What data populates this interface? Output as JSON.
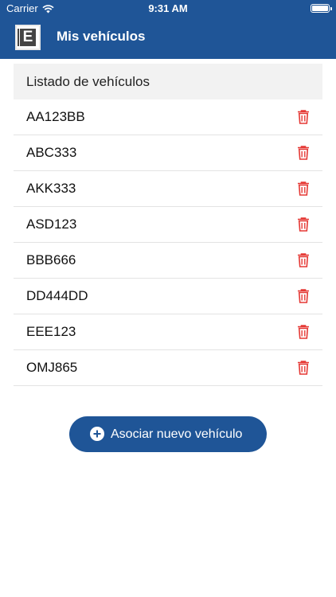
{
  "status_bar": {
    "carrier": "Carrier",
    "time": "9:31 AM"
  },
  "header": {
    "title": "Mis vehículos"
  },
  "list": {
    "heading": "Listado de vehículos",
    "items": [
      {
        "plate": "AA123BB"
      },
      {
        "plate": "ABC333"
      },
      {
        "plate": "AKK333"
      },
      {
        "plate": "ASD123"
      },
      {
        "plate": "BBB666"
      },
      {
        "plate": "DD444DD"
      },
      {
        "plate": "EEE123"
      },
      {
        "plate": "OMJ865"
      }
    ]
  },
  "actions": {
    "add_vehicle_label": "Asociar nuevo vehículo"
  },
  "colors": {
    "primary": "#1f5597",
    "delete": "#e53935",
    "header_bg": "#f2f2f2"
  },
  "icons": {
    "delete": "trash-icon",
    "add": "plus-circle-icon",
    "logo": "e-logo-icon"
  }
}
